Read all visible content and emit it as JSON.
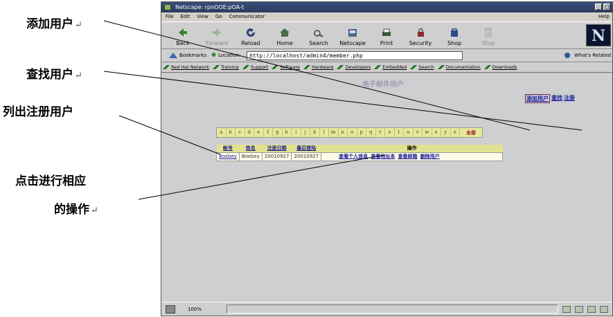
{
  "callouts": {
    "add_user": "添加用户",
    "search_user": "查找用户",
    "list_users": "列出注册用户",
    "operate_line1": "点击进行相应",
    "operate_line2": "的操作",
    "arrow_mark": "↵"
  },
  "browser": {
    "window_title": "Netscape: rpnOOE:pOA-t",
    "menu": [
      "File",
      "Edit",
      "View",
      "Go",
      "Communicator"
    ],
    "help": "Help",
    "toolbar": [
      "Back",
      "Forward",
      "Reload",
      "Home",
      "Search",
      "Netscape",
      "Print",
      "Security",
      "Shop",
      "Stop"
    ],
    "bookmarks_label": "Bookmarks",
    "location_label": "Location:",
    "url": "http://localhost/admin4/member.php",
    "whats_related": "What's Related",
    "personal_toolbar": [
      "Red Hat Network",
      "Training",
      "Support",
      "Software",
      "Hardware",
      "Developers",
      "Embedded",
      "Search",
      "Documentation",
      "Downloads"
    ],
    "zoom": "100%"
  },
  "page": {
    "title": "电子邮件用户",
    "top_links": [
      "添加用户",
      "查找",
      "注册"
    ],
    "letters": [
      "a",
      "b",
      "c",
      "d",
      "e",
      "f",
      "g",
      "h",
      "i",
      "j",
      "k",
      "l",
      "m",
      "n",
      "o",
      "p",
      "q",
      "r",
      "s",
      "t",
      "u",
      "v",
      "w",
      "x",
      "y",
      "z"
    ],
    "all_label": "全部",
    "table_headers": [
      "帐号",
      "姓名",
      "注册日期",
      "最后登陆",
      "操作"
    ],
    "rows": [
      {
        "account": "Boxbey",
        "name": "Boxbey",
        "reg_date": "20010927",
        "last_login": "20010927",
        "ops": [
          "查看个人信息",
          "查看地址本",
          "查看邮箱",
          "删除用户"
        ]
      }
    ]
  }
}
